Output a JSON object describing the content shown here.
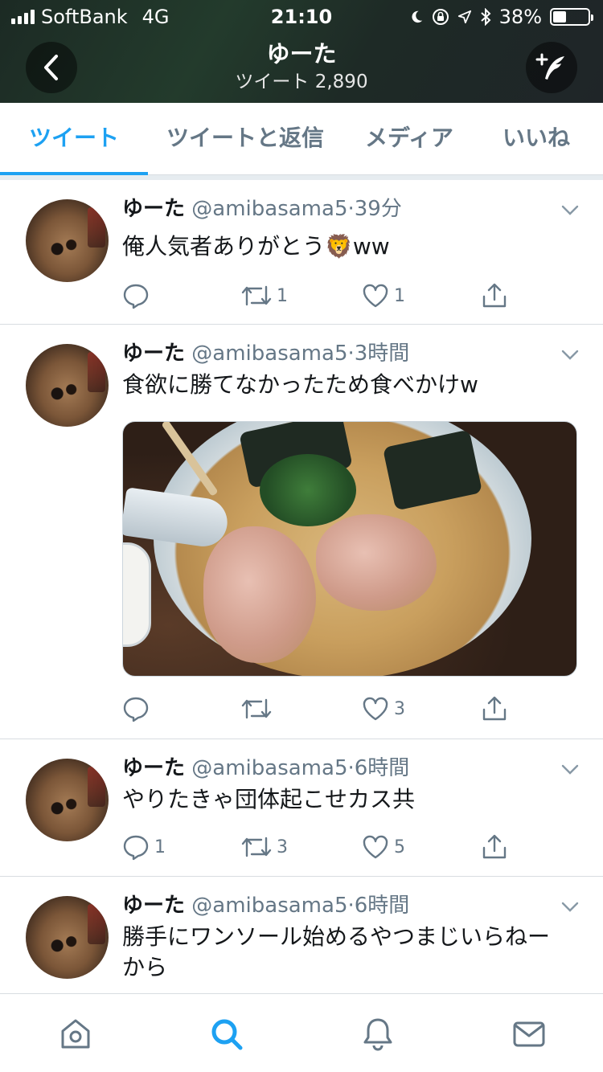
{
  "status_bar": {
    "carrier": "SoftBank",
    "network": "4G",
    "time": "21:10",
    "battery": "38%",
    "battery_level": 0.38
  },
  "header": {
    "title": "ゆーた",
    "subtitle": "ツイート 2,890"
  },
  "tabs": [
    {
      "label": "ツイート",
      "active": true
    },
    {
      "label": "ツイートと返信",
      "active": false
    },
    {
      "label": "メディア",
      "active": false
    },
    {
      "label": "いいね",
      "active": false
    }
  ],
  "tweets": [
    {
      "name": "ゆーた",
      "handle": "@amibasama5",
      "time": "39分",
      "text": "俺人気者ありがとう🦁ww",
      "replies": "",
      "retweets": "1",
      "likes": "1",
      "has_media": false
    },
    {
      "name": "ゆーた",
      "handle": "@amibasama5",
      "time": "3時間",
      "text": "食欲に勝てなかったため食べかけw",
      "replies": "",
      "retweets": "",
      "likes": "3",
      "has_media": true
    },
    {
      "name": "ゆーた",
      "handle": "@amibasama5",
      "time": "6時間",
      "text": "やりたきゃ団体起こせカス共",
      "replies": "1",
      "retweets": "3",
      "likes": "5",
      "has_media": false
    },
    {
      "name": "ゆーた",
      "handle": "@amibasama5",
      "time": "6時間",
      "text": "勝手にワンソール始めるやつまじいらねーから",
      "replies": "",
      "retweets": "",
      "likes": "",
      "has_media": false
    }
  ],
  "colors": {
    "accent": "#1da1f2",
    "secondary_text": "#657786",
    "primary_text": "#14171a"
  }
}
